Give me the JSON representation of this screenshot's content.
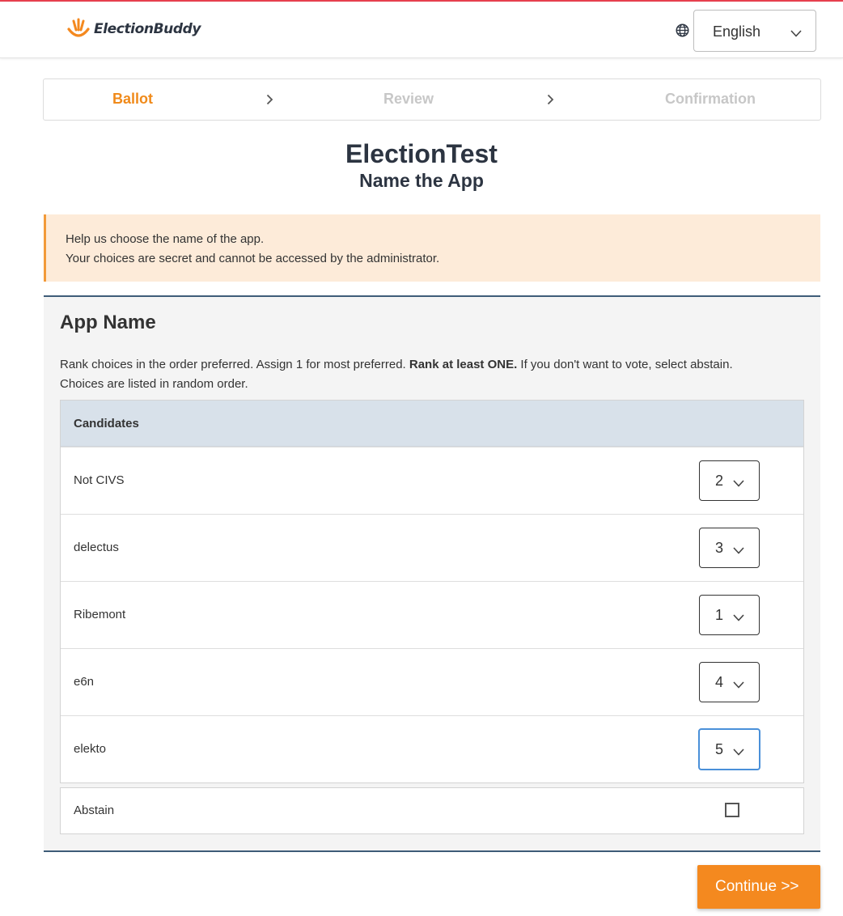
{
  "header": {
    "logo_text": "ElectionBuddy",
    "language": {
      "selected": "English",
      "icon": "globe-icon"
    }
  },
  "steps": [
    {
      "label": "Ballot",
      "state": "active"
    },
    {
      "label": "Review",
      "state": "inactive"
    },
    {
      "label": "Confirmation",
      "state": "inactive"
    }
  ],
  "election": {
    "title": "ElectionTest",
    "subtitle": "Name the App"
  },
  "notice": {
    "line1": "Help us choose the name of the app.",
    "line2": "Your choices are secret and cannot be accessed by the administrator."
  },
  "question": {
    "title": "App Name",
    "instr_part1": "Rank choices in the order preferred. Assign 1 for most preferred. ",
    "instr_bold": "Rank at least ONE.",
    "instr_part2": " If you don't want to vote, select abstain.",
    "instr_line2": "Choices are listed in random order.",
    "table_header": "Candidates",
    "candidates": [
      {
        "name": "Not CIVS",
        "rank": "2"
      },
      {
        "name": "delectus",
        "rank": "3"
      },
      {
        "name": "Ribemont",
        "rank": "1"
      },
      {
        "name": "e6n",
        "rank": "4"
      },
      {
        "name": "elekto",
        "rank": "5"
      }
    ],
    "abstain_label": "Abstain",
    "abstain_checked": false
  },
  "actions": {
    "continue_label": "Continue >>"
  },
  "colors": {
    "accent": "#f4891f",
    "active_step": "#f08a1a",
    "inactive_step": "#c7c7c7",
    "notice_bg": "#fdebd9",
    "notice_border": "#f29a3a",
    "section_border": "#3e5c78",
    "table_header_bg": "#d8e1ea",
    "top_line": "#e8414f",
    "focus": "#4a90d9"
  }
}
